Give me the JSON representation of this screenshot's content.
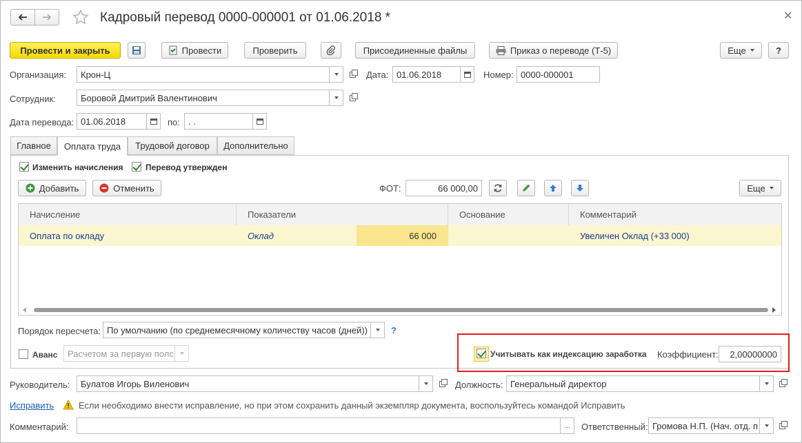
{
  "title": "Кадровый перевод 0000-000001 от 01.06.2018 *",
  "toolbar": {
    "post_close": "Провести и закрыть",
    "post": "Провести",
    "check": "Проверить",
    "attached": "Присоединенные файлы",
    "order": "Приказ о переводе (Т-5)",
    "more": "Еще",
    "help": "?"
  },
  "header": {
    "org_label": "Организация:",
    "org_value": "Крон-Ц",
    "date_label": "Дата:",
    "date_value": "01.06.2018",
    "number_label": "Номер:",
    "number_value": "0000-000001",
    "employee_label": "Сотрудник:",
    "employee_value": "Боровой Дмитрий Валентинович",
    "transfer_date_label": "Дата перевода:",
    "transfer_date_value": "01.06.2018",
    "to_label": "по:",
    "to_value": " .  ."
  },
  "tabs": [
    "Главное",
    "Оплата труда",
    "Трудовой договор",
    "Дополнительно"
  ],
  "pay": {
    "change_accruals": "Изменить начисления",
    "transfer_approved": "Перевод утвержден",
    "add": "Добавить",
    "cancel": "Отменить",
    "fot_label": "ФОТ:",
    "fot_value": "66 000,00",
    "more": "Еще",
    "columns": [
      "Начисление",
      "Показатели",
      "Основание",
      "Комментарий"
    ],
    "row": {
      "accrual": "Оплата по окладу",
      "indicator": "Оклад",
      "amount": "66 000",
      "basis": "",
      "comment": "Увеличен Оклад (+33 000)"
    },
    "recalc_label": "Порядок пересчета:",
    "recalc_value": "По умолчанию (по среднемесячному количеству часов (дней))",
    "recalc_help": "?",
    "advance_label": "Аванс",
    "advance_value": "Расчетом за первую полс",
    "indexation_label": "Учитывать как индексацию заработка",
    "coef_label": "Коэффициент:",
    "coef_value": "2,00000000"
  },
  "footer": {
    "manager_label": "Руководитель:",
    "manager_value": "Булатов Игорь Виленович",
    "position_label": "Должность:",
    "position_value": "Генеральный директор",
    "fix_link": "Исправить",
    "fix_note": "Если необходимо внести исправление, но при этом сохранить данный экземпляр документа, воспользуйтесь командой Исправить",
    "comment_label": "Комментарий:",
    "comment_value": "",
    "comment_btn": "...",
    "responsible_label": "Ответственный:",
    "responsible_value": "Громова Н.П. (Нач. отд. п"
  },
  "colors": {
    "primary_button": "#f5d900",
    "highlight_border": "#e0201b",
    "link": "#1a3d8f",
    "row_bg": "#fbf6cf"
  }
}
